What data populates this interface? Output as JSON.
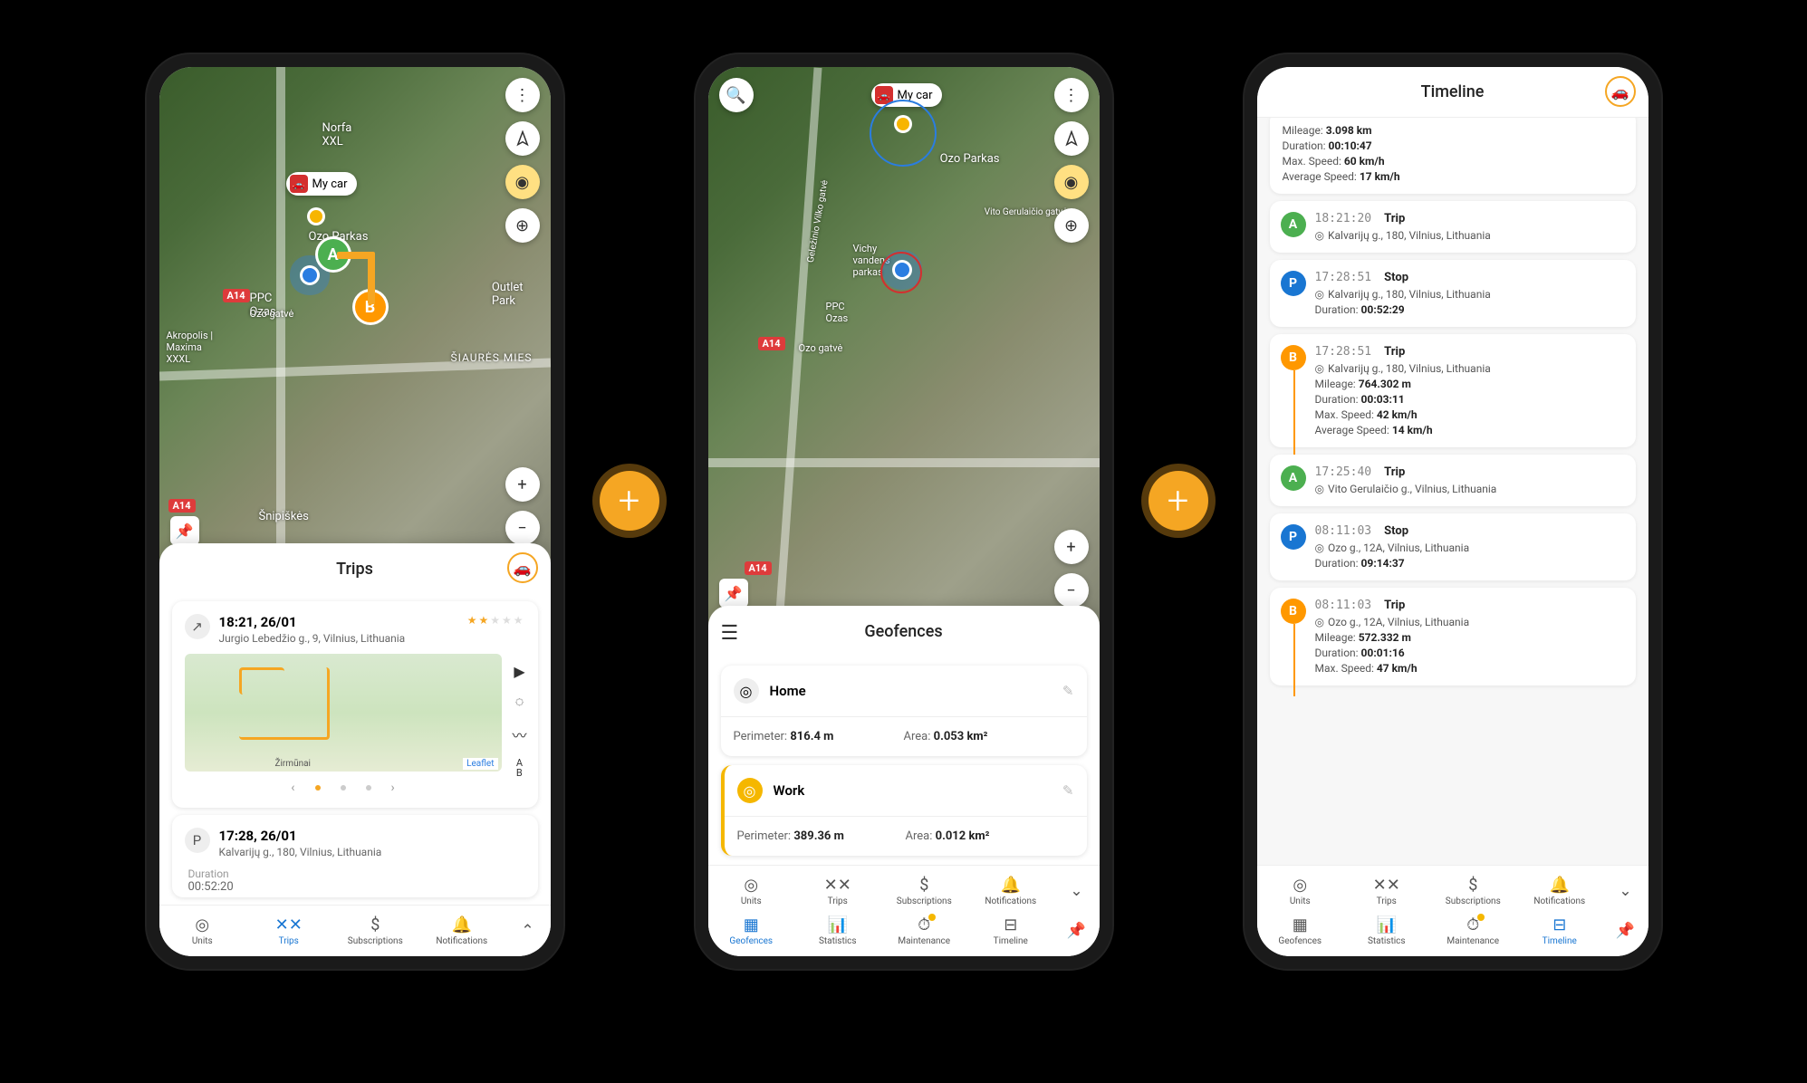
{
  "unit_label": "My car",
  "trips": {
    "title": "Trips",
    "item1": {
      "time": "18:21, 26/01",
      "address": "Jurgio Lebedžio g., 9, Vilnius, Lithuania",
      "leaflet": "Leaflet",
      "ab_label": "A\nB"
    },
    "item2": {
      "time": "17:28, 26/01",
      "address": "Kalvarijų g., 180, Vilnius, Lithuania",
      "duration_label": "Duration",
      "duration": "00:52:20"
    }
  },
  "geofences": {
    "title": "Geofences",
    "home": {
      "name": "Home",
      "perimeter_label": "Perimeter: ",
      "perimeter": "816.4 m",
      "area_label": "Area: ",
      "area": "0.053 km²"
    },
    "work": {
      "name": "Work",
      "perimeter_label": "Perimeter: ",
      "perimeter": "389.36 m",
      "area_label": "Area: ",
      "area": "0.012 km²"
    }
  },
  "timeline": {
    "title": "Timeline",
    "events": [
      {
        "badge": "",
        "stats": [
          {
            "l": "Mileage: ",
            "v": "3.098 km"
          },
          {
            "l": "Duration: ",
            "v": "00:10:47"
          },
          {
            "l": "Max. Speed: ",
            "v": "60 km/h"
          },
          {
            "l": "Average Speed: ",
            "v": "17 km/h"
          }
        ]
      },
      {
        "badge": "A",
        "time": "18:21:20",
        "type": "Trip",
        "loc": "Kalvarijų g., 180, Vilnius, Lithuania"
      },
      {
        "badge": "P",
        "time": "17:28:51",
        "type": "Stop",
        "loc": "Kalvarijų g., 180, Vilnius, Lithuania",
        "stats": [
          {
            "l": "Duration: ",
            "v": "00:52:29"
          }
        ]
      },
      {
        "badge": "B",
        "time": "17:28:51",
        "type": "Trip",
        "loc": "Kalvarijų g., 180, Vilnius, Lithuania",
        "stats": [
          {
            "l": "Mileage: ",
            "v": "764.302 m"
          },
          {
            "l": "Duration: ",
            "v": "00:03:11"
          },
          {
            "l": "Max. Speed: ",
            "v": "42 km/h"
          },
          {
            "l": "Average Speed: ",
            "v": "14 km/h"
          }
        ]
      },
      {
        "badge": "A",
        "time": "17:25:40",
        "type": "Trip",
        "loc": "Vito Gerulaičio g., Vilnius, Lithuania"
      },
      {
        "badge": "P",
        "time": "08:11:03",
        "type": "Stop",
        "loc": "Ozo g., 12A, Vilnius, Lithuania",
        "stats": [
          {
            "l": "Duration: ",
            "v": "09:14:37"
          }
        ]
      },
      {
        "badge": "B",
        "time": "08:11:03",
        "type": "Trip",
        "loc": "Ozo g., 12A, Vilnius, Lithuania",
        "stats": [
          {
            "l": "Mileage: ",
            "v": "572.332 m"
          },
          {
            "l": "Duration: ",
            "v": "00:01:16"
          },
          {
            "l": "Max. Speed: ",
            "v": "47 km/h"
          }
        ]
      }
    ]
  },
  "map_labels": {
    "norfa": "Norfa\nXXL",
    "ozo_parkas": "Ozo Parkas",
    "ozas": "PPC\nOzas",
    "outlet": "Outlet\nPark",
    "akropolis": "Akropolis |\nMaxima\nXXXL",
    "snipiskes": "Šnipiškės",
    "siaures": "ŠIAURĖS MIES",
    "ozo_gatve": "Ozo gatvė",
    "a14": "A14",
    "gelezinio": "Geležinio Vilko gatvė",
    "vichy": "Vichy\nvandens\nparkas",
    "vito": "Vito Gerulaičio gatvė",
    "zirmunai": "Žirmūnai"
  },
  "nav": {
    "units": "Units",
    "trips": "Trips",
    "subscriptions": "Subscriptions",
    "notifications": "Notifications",
    "geofences": "Geofences",
    "statistics": "Statistics",
    "maintenance": "Maintenance",
    "timeline": "Timeline"
  }
}
